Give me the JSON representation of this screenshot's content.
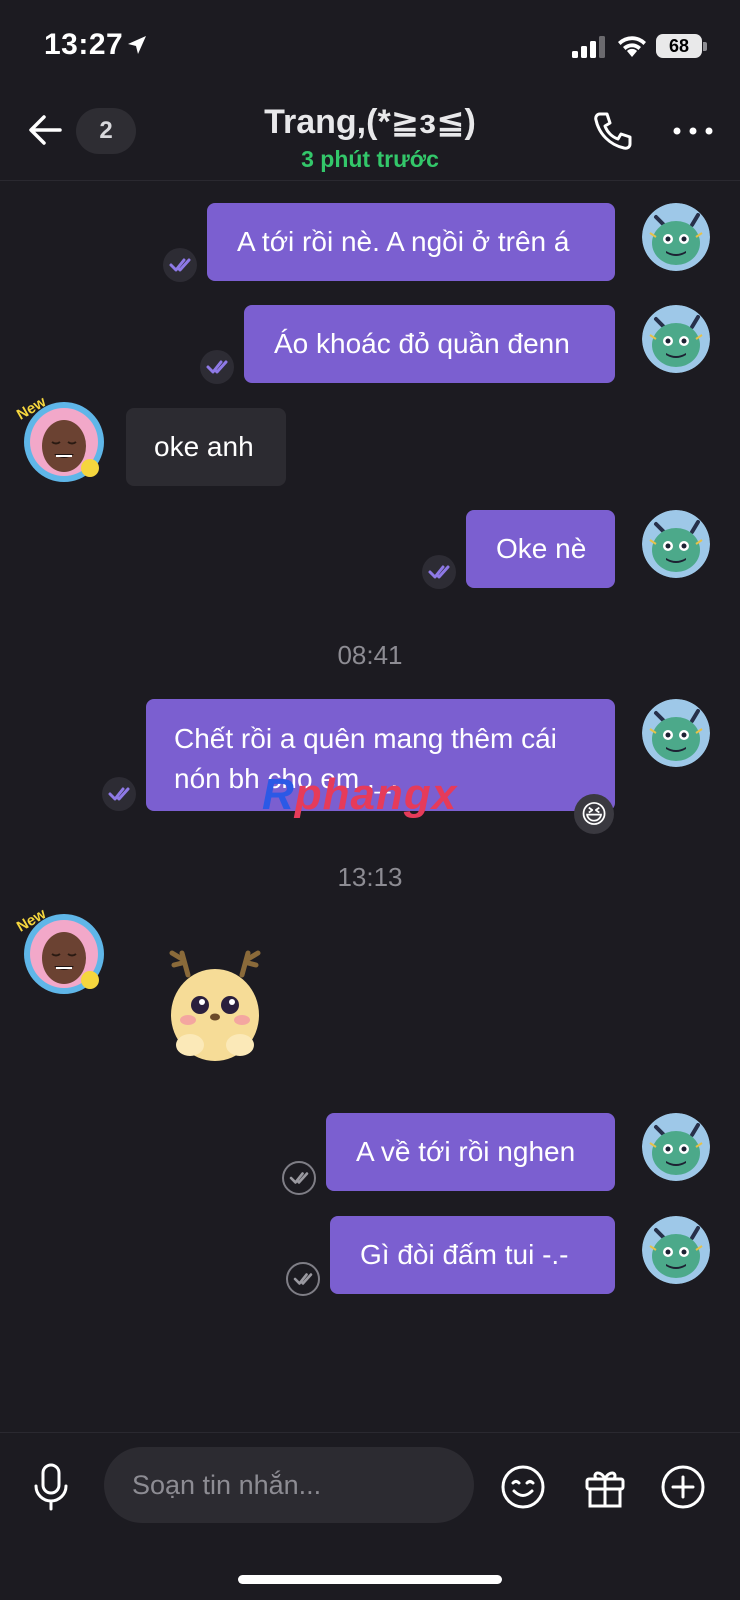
{
  "status_bar": {
    "time": "13:27",
    "battery": "68"
  },
  "header": {
    "unread_count": "2",
    "name": "Trang,(*≧з≦)",
    "status": "3 phút trước"
  },
  "messages": [
    {
      "direction": "out",
      "text": "A tới rồi nè. A ngồi ở trên á"
    },
    {
      "direction": "out",
      "text": "Áo khoác đỏ quần đenn"
    },
    {
      "direction": "in",
      "text": "oke anh"
    },
    {
      "direction": "out",
      "text": "Oke nè"
    },
    {
      "direction": "time",
      "text": "08:41"
    },
    {
      "direction": "out",
      "text": "Chết rồi a quên mang thêm cái nón bh cho em ._.",
      "reaction": "😆"
    },
    {
      "direction": "time",
      "text": "13:13"
    },
    {
      "direction": "in",
      "sticker": "deer-sticker"
    },
    {
      "direction": "out",
      "text": "A về tới rồi nghen"
    },
    {
      "direction": "out",
      "text": "Gì đòi đấm tui -.-"
    }
  ],
  "avatar_badge": "New",
  "watermark": "Rphangx",
  "input": {
    "placeholder": "Soạn tin nhắn..."
  },
  "icons": [
    "back-arrow-icon",
    "phone-icon",
    "more-dots-icon",
    "mic-icon",
    "emoji-icon",
    "gift-icon",
    "plus-icon",
    "double-check-icon"
  ],
  "colors": {
    "background": "#1c1b21",
    "outgoing_bubble": "#7b5fd0",
    "incoming_bubble": "#2c2b31",
    "status_green": "#33c76a"
  }
}
